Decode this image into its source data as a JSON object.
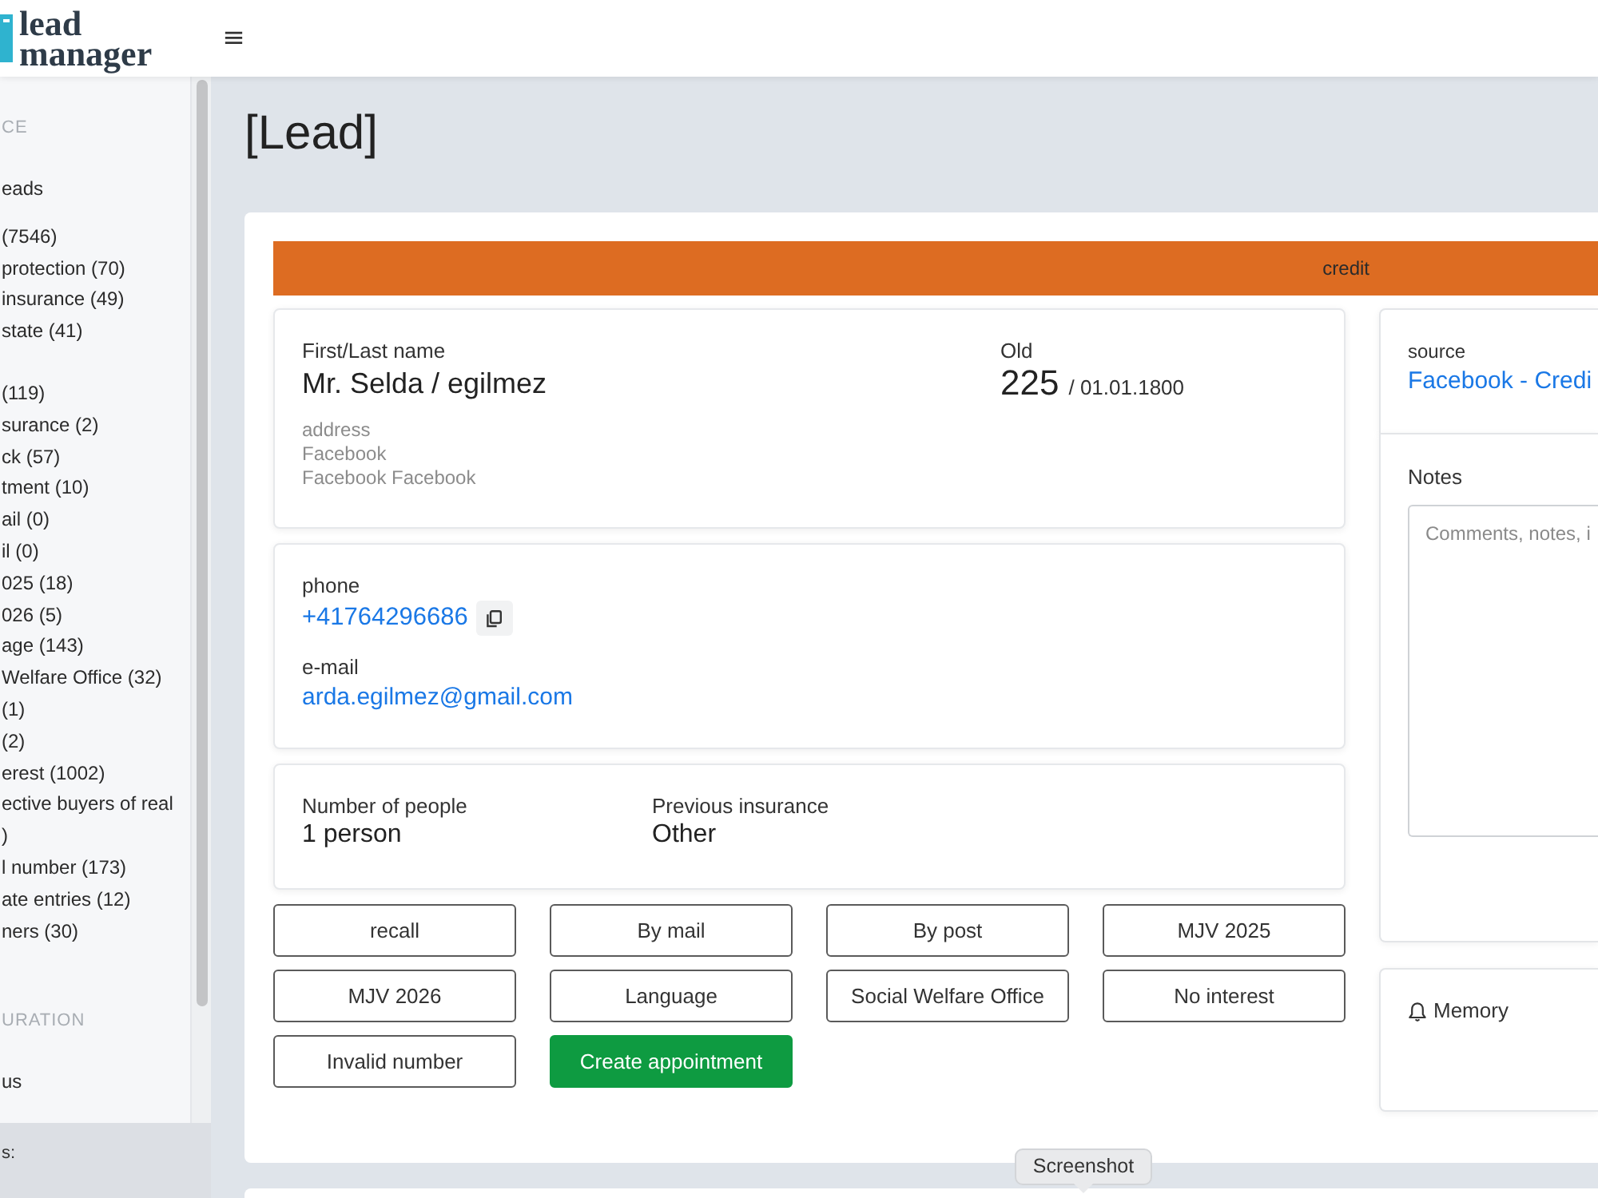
{
  "header": {
    "logo_lines": [
      "lead",
      "manager"
    ],
    "menu_glyph": "≡"
  },
  "sidebar": {
    "sections": [
      {
        "heading": "CE",
        "groups": [
          [
            "eads"
          ],
          [
            "(7546)",
            "protection (70)",
            "insurance (49)",
            "state (41)"
          ],
          [
            "(119)",
            "surance (2)",
            "ck (57)",
            "tment (10)",
            "ail (0)",
            "il (0)",
            "025 (18)",
            "026 (5)",
            "age (143)",
            "Welfare Office (32)",
            "(1)",
            "(2)",
            "erest (1002)",
            "ective buyers of real\n)",
            "l number (173)",
            "ate entries (12)",
            "ners (30)"
          ]
        ]
      },
      {
        "heading": "URATION",
        "groups": [
          [
            "us"
          ]
        ]
      }
    ],
    "footer": "s:"
  },
  "page_title": "[Lead]",
  "lead": {
    "category": "credit",
    "person": {
      "name_label": "First/Last name",
      "name": "Mr. Selda / egilmez",
      "address_label": "address",
      "address_lines": [
        "Facebook",
        "Facebook Facebook"
      ],
      "age_label": "Old",
      "age": "225",
      "birth_date": "/ 01.01.1800"
    },
    "contact": {
      "phone_label": "phone",
      "phone": "+41764296686",
      "email_label": "e-mail",
      "email": "arda.egilmez@gmail.com"
    },
    "details": [
      {
        "label": "Number of people",
        "value": "1 person"
      },
      {
        "label": "Previous insurance",
        "value": "Other"
      }
    ],
    "actions": [
      {
        "label": "recall",
        "kind": "outline"
      },
      {
        "label": "By mail",
        "kind": "outline"
      },
      {
        "label": "By post",
        "kind": "outline"
      },
      {
        "label": "MJV 2025",
        "kind": "outline"
      },
      {
        "label": "MJV 2026",
        "kind": "outline"
      },
      {
        "label": "Language",
        "kind": "outline"
      },
      {
        "label": "Social Welfare Office",
        "kind": "outline"
      },
      {
        "label": "No interest",
        "kind": "outline"
      },
      {
        "label": "Invalid number",
        "kind": "outline"
      },
      {
        "label": "Create appointment",
        "kind": "primary"
      }
    ],
    "source": {
      "label": "source",
      "value": "Facebook - Credi"
    },
    "notes": {
      "label": "Notes",
      "placeholder": "Comments, notes, i"
    },
    "memory": {
      "label": "Memory"
    }
  },
  "tooltip": "Screenshot"
}
